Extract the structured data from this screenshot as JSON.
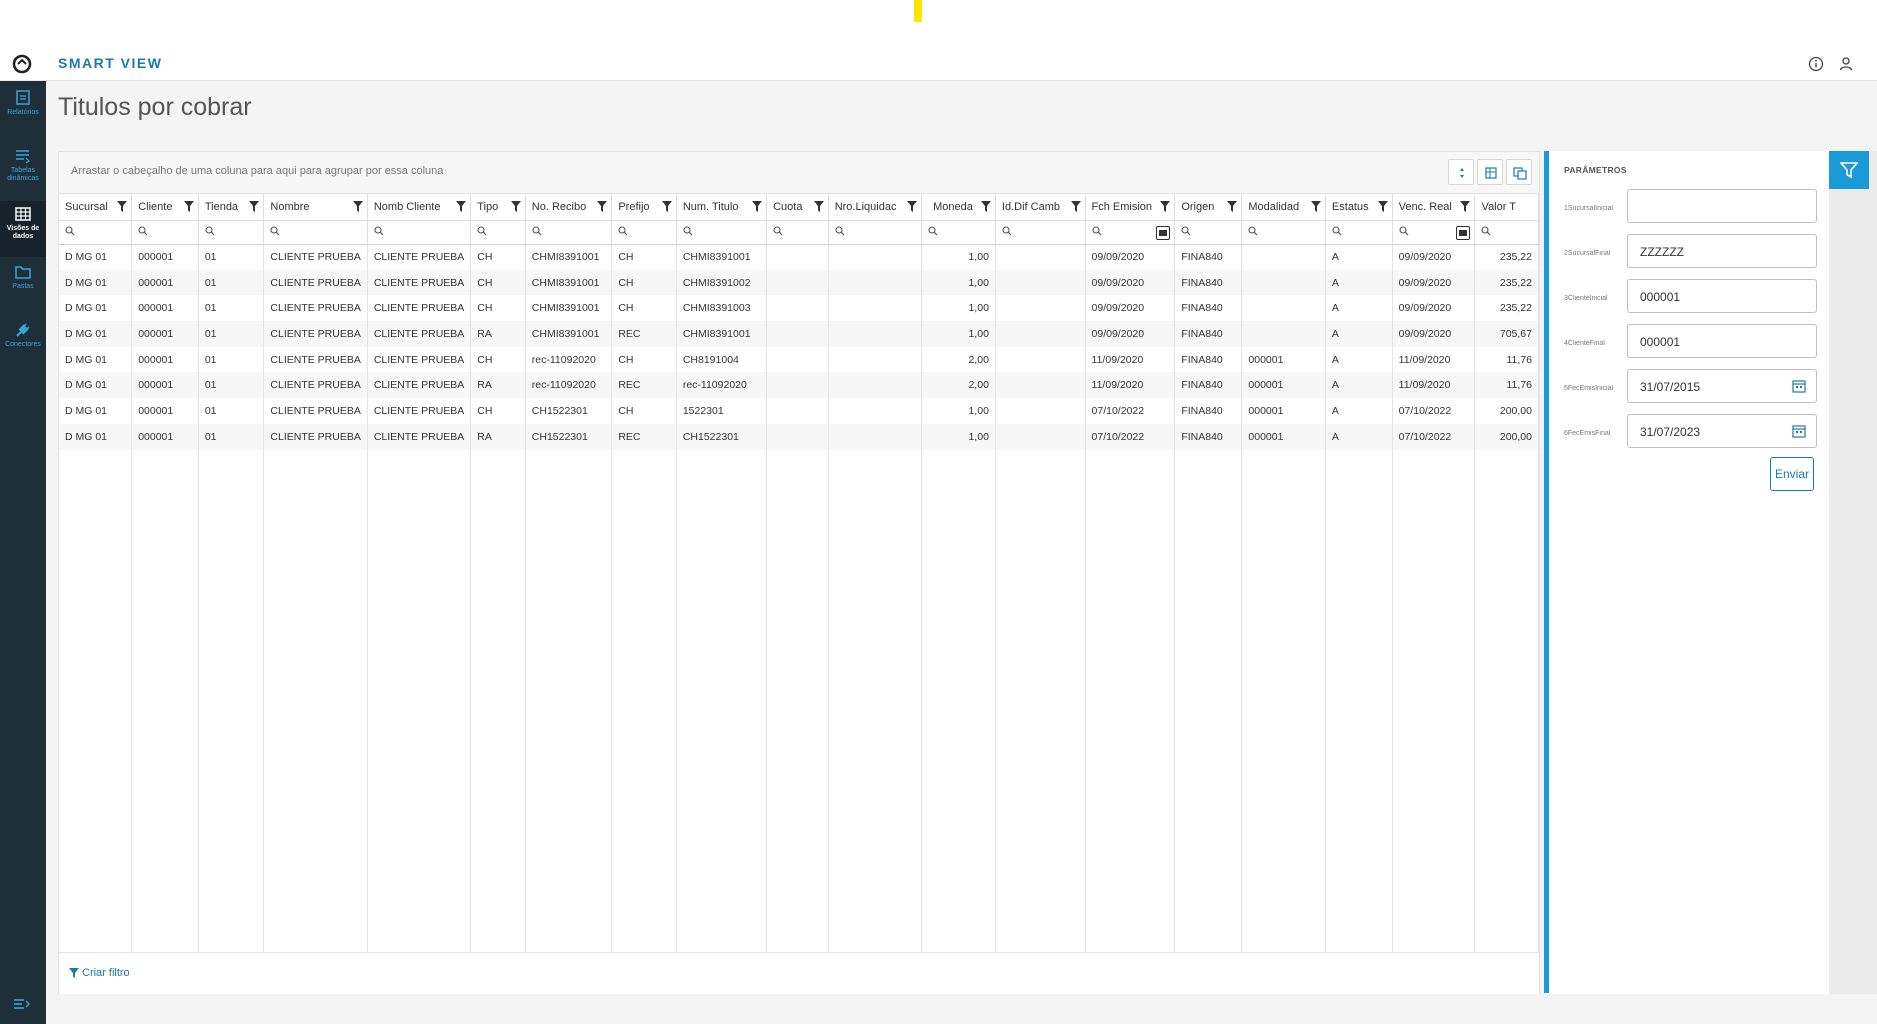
{
  "app": {
    "title": "SMART VIEW"
  },
  "sidebar": {
    "items": [
      {
        "label": "Relatórios",
        "icon": "report-icon"
      },
      {
        "label": "Tabelas dinâmicas",
        "icon": "pivot-table-icon"
      },
      {
        "label": "Visões de dados",
        "icon": "data-grid-icon",
        "active": true
      },
      {
        "label": "Pastas",
        "icon": "folder-icon"
      },
      {
        "label": "Conectores",
        "icon": "plug-icon"
      }
    ]
  },
  "page": {
    "title": "Titulos por cobrar"
  },
  "grid": {
    "group_hint": "Arrastar o cabeçalho de uma coluna para aqui para agrupar por essa coluna",
    "columns": [
      "Sucursal",
      "Cliente",
      "Tienda",
      "Nombre",
      "Nomb Cliente",
      "Tipo",
      "No. Recibo",
      "Prefijo",
      "Num. Titulo",
      "Cuota",
      "Nro.Liquidac",
      "Moneda",
      "Id.Dif Camb",
      "Fch Emision",
      "Origen",
      "Modalidad",
      "Estatus",
      "Venc. Real",
      "Valor T"
    ],
    "rows": [
      [
        "D MG 01",
        "000001",
        "01",
        "CLIENTE PRUEBA",
        "CLIENTE PRUEBA",
        "CH",
        "CHMI8391001",
        "CH",
        "CHMI8391001",
        "",
        "",
        "1,00",
        "",
        "09/09/2020",
        "FINA840",
        "",
        "A",
        "09/09/2020",
        "235,22"
      ],
      [
        "D MG 01",
        "000001",
        "01",
        "CLIENTE PRUEBA",
        "CLIENTE PRUEBA",
        "CH",
        "CHMI8391001",
        "CH",
        "CHMI8391002",
        "",
        "",
        "1,00",
        "",
        "09/09/2020",
        "FINA840",
        "",
        "A",
        "09/09/2020",
        "235,22"
      ],
      [
        "D MG 01",
        "000001",
        "01",
        "CLIENTE PRUEBA",
        "CLIENTE PRUEBA",
        "CH",
        "CHMI8391001",
        "CH",
        "CHMI8391003",
        "",
        "",
        "1,00",
        "",
        "09/09/2020",
        "FINA840",
        "",
        "A",
        "09/09/2020",
        "235,22"
      ],
      [
        "D MG 01",
        "000001",
        "01",
        "CLIENTE PRUEBA",
        "CLIENTE PRUEBA",
        "RA",
        "CHMI8391001",
        "REC",
        "CHMI8391001",
        "",
        "",
        "1,00",
        "",
        "09/09/2020",
        "FINA840",
        "",
        "A",
        "09/09/2020",
        "705,67"
      ],
      [
        "D MG 01",
        "000001",
        "01",
        "CLIENTE PRUEBA",
        "CLIENTE PRUEBA",
        "CH",
        "rec-11092020",
        "CH",
        "CH8191004",
        "",
        "",
        "2,00",
        "",
        "11/09/2020",
        "FINA840",
        "000001",
        "A",
        "11/09/2020",
        "11,76"
      ],
      [
        "D MG 01",
        "000001",
        "01",
        "CLIENTE PRUEBA",
        "CLIENTE PRUEBA",
        "RA",
        "rec-11092020",
        "REC",
        "rec-11092020",
        "",
        "",
        "2,00",
        "",
        "11/09/2020",
        "FINA840",
        "000001",
        "A",
        "11/09/2020",
        "11,76"
      ],
      [
        "D MG 01",
        "000001",
        "01",
        "CLIENTE PRUEBA",
        "CLIENTE PRUEBA",
        "CH",
        "CH1522301",
        "CH",
        "1522301",
        "",
        "",
        "1,00",
        "",
        "07/10/2022",
        "FINA840",
        "000001",
        "A",
        "07/10/2022",
        "200,00"
      ],
      [
        "D MG 01",
        "000001",
        "01",
        "CLIENTE PRUEBA",
        "CLIENTE PRUEBA",
        "RA",
        "CH1522301",
        "REC",
        "CH1522301",
        "",
        "",
        "1,00",
        "",
        "07/10/2022",
        "FINA840",
        "000001",
        "A",
        "07/10/2022",
        "200,00"
      ]
    ],
    "create_filter": "Criar filtro"
  },
  "params": {
    "title": "PARÂMETROS",
    "fields": [
      {
        "label": "1SucursalInicial",
        "value": ""
      },
      {
        "label": "2SucursalFinal",
        "value": "ZZZZZZ"
      },
      {
        "label": "3ClienteInicial",
        "value": "000001"
      },
      {
        "label": "4ClienteFinal",
        "value": "000001"
      },
      {
        "label": "5FecEmisInicial",
        "value": "31/07/2015"
      },
      {
        "label": "6FecEmisFinal",
        "value": "31/07/2023"
      }
    ],
    "submit": "Enviar"
  },
  "colors": {
    "accent": "#1a9ad6",
    "brand_text": "#1a7ba8",
    "sidebar_bg": "#1f2f3a"
  }
}
